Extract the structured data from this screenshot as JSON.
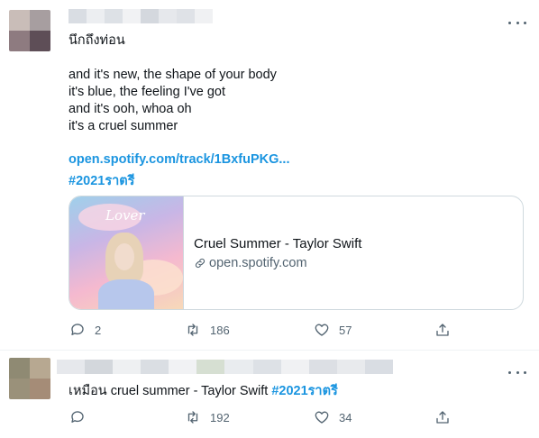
{
  "tweets": [
    {
      "text_lines": [
        "นึกถึงท่อน",
        "",
        "and it's new, the shape of your body",
        "it's blue, the feeling I've got",
        "and it's ooh, whoa oh",
        "it's a cruel summer"
      ],
      "link": "open.spotify.com/track/1BxfuPKG...",
      "hashtag": "#2021ราตรี",
      "card": {
        "image_text": "Lover",
        "title": "Cruel Summer - Taylor Swift",
        "domain": "open.spotify.com"
      },
      "actions": {
        "reply_count": "2",
        "retweet_count": "186",
        "like_count": "57"
      }
    },
    {
      "text": "เหมือน cruel summer - Taylor Swift",
      "hashtag": "#2021ราตรี",
      "actions": {
        "reply_count": "",
        "retweet_count": "192",
        "like_count": "34"
      }
    }
  ],
  "icons": {
    "more": "more-icon",
    "reply": "reply-icon",
    "retweet": "retweet-icon",
    "like": "heart-icon",
    "share": "share-icon",
    "link": "link-icon"
  },
  "colors": {
    "accent": "#1d9bf0",
    "muted": "#536471"
  }
}
